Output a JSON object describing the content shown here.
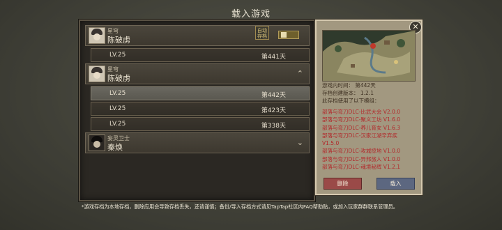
{
  "title": "载入游戏",
  "groups": [
    {
      "role": "星穹",
      "name": "陈破虏",
      "badge": "自动存档",
      "saves": [
        {
          "level": "LV.25",
          "day": "第441天"
        }
      ]
    },
    {
      "role": "星穹",
      "name": "陈破虏",
      "saves": [
        {
          "level": "LV.25",
          "day": "第442天"
        },
        {
          "level": "LV.25",
          "day": "第423天"
        },
        {
          "level": "LV.25",
          "day": "第338天"
        }
      ]
    },
    {
      "role": "妄灵卫士",
      "name": "秦焕"
    }
  ],
  "detail": {
    "game_time": "游戏内时间：  第442天",
    "version": "存档创建版本：  1.2.1",
    "mods_heading": "此存档使用了以下模组：",
    "mods": [
      "部落与弯刀DLC-比武大会 V2.0.0",
      "部落与弯刀DLC-聚义工坊 V1.6.0",
      "部落与弯刀DLC-养儿育女 V1.6.3",
      "部落与弯刀DLC-汉家江湖辛弃疾",
      "V1.5.0",
      "部落与弯刀DLC-攻城掠地 V1.0.0",
      "部落与弯刀DLC-异邦旅人 V1.0.0",
      "部落与弯刀DLC-魂境秘辉 V1.2.1"
    ],
    "delete_label": "删除",
    "load_label": "载入"
  },
  "footnote": "*游戏存档为本地存档，删除应用会导致存档丢失，还请谨慎；备份/导入存档方式请见TapTap社区内FAQ帮助贴，或加入玩家群群联系管理员。",
  "colors": {
    "selected_row": "#64625a",
    "mod_text": "#b2282a",
    "delete_button": "#9a4a48",
    "load_button": "#5c6780"
  }
}
